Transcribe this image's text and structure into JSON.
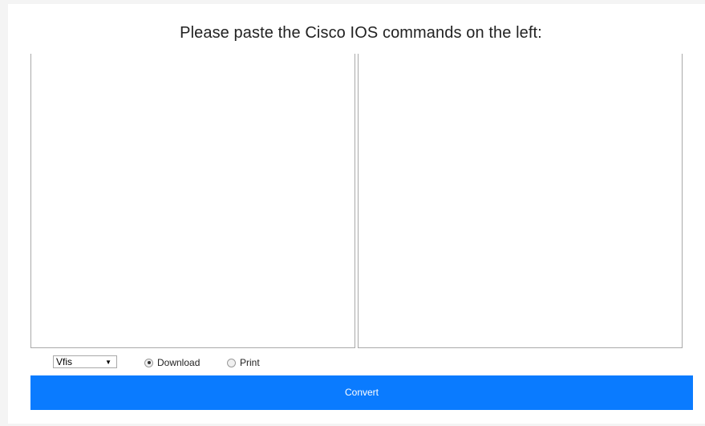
{
  "title": "Please paste the Cisco IOS commands on the left:",
  "input_area": {
    "value": ""
  },
  "output_area": {
    "value": ""
  },
  "format_select": {
    "selected": "Vfis",
    "arrow": "▼"
  },
  "output_mode": {
    "download_label": "Download",
    "print_label": "Print",
    "selected": "download"
  },
  "convert_button": {
    "label": "Convert"
  },
  "colors": {
    "accent": "#0a7bff",
    "border": "#a9a9a9"
  }
}
